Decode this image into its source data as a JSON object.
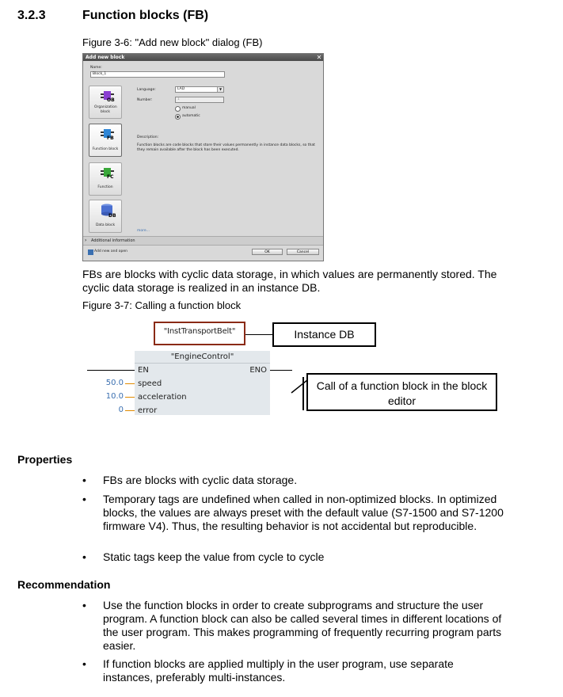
{
  "section": {
    "number": "3.2.3",
    "title": "Function blocks (FB)"
  },
  "figure1": {
    "caption": "Figure 3-6: \"Add new block\" dialog (FB)",
    "dialog": {
      "title": "Add new block",
      "name_label": "Name:",
      "name_value": "Block_1",
      "language_label": "Language:",
      "language_value": "LAD",
      "number_label": "Number:",
      "number_value": "1",
      "radio_manual": "manual",
      "radio_automatic": "automatic",
      "description_label": "Description:",
      "description_text": "Function blocks are code blocks that store their values permanently in instance data blocks, so that they remain available after the block has been executed.",
      "more_link": "more...",
      "blocks": [
        {
          "label": "Organization block",
          "badge": "OB",
          "color": "#8a3fd1"
        },
        {
          "label": "Function block",
          "badge": "FB",
          "color": "#2f86d6"
        },
        {
          "label": "Function",
          "badge": "FC",
          "color": "#3aa83a"
        },
        {
          "label": "Data block",
          "badge": "DB",
          "color": "#4a6fd0"
        }
      ],
      "additional_info": "Additional information",
      "add_new_open": "Add new and open",
      "ok_label": "OK",
      "cancel_label": "Cancel"
    }
  },
  "para1": "FBs are blocks with cyclic data storage, in which values are permanently stored. The cyclic data storage is realized in an instance DB.",
  "figure2": {
    "caption": "Figure 3-7: Calling a function block",
    "instance_name": "\"InstTransportBelt\"",
    "instance_callout": "Instance DB",
    "block_name": "\"EngineControl\"",
    "en_label": "EN",
    "eno_label": "ENO",
    "pins": [
      {
        "name": "speed",
        "value": "50.0"
      },
      {
        "name": "acceleration",
        "value": "10.0"
      },
      {
        "name": "error",
        "value": "0"
      }
    ],
    "call_callout": "Call of a function block in the block editor"
  },
  "properties": {
    "heading": "Properties",
    "items": [
      "FBs are blocks with cyclic data storage.",
      "Temporary tags are undefined when called in non-optimized blocks. In optimized blocks, the values are always preset with the default value (S7-1500 and S7-1200 firmware V4). Thus, the resulting behavior is not accidental but reproducible.",
      "Static tags keep the value from cycle to cycle"
    ]
  },
  "recommendation": {
    "heading": "Recommendation",
    "items": [
      "Use the function blocks in order to create subprograms and structure the user program. A function block can also be called several times in different locations of the user program. This makes programming of frequently recurring program parts easier.",
      "If function blocks are applied multiply in the user program, use separate instances, preferably multi-instances."
    ]
  },
  "bullet_char": "•"
}
